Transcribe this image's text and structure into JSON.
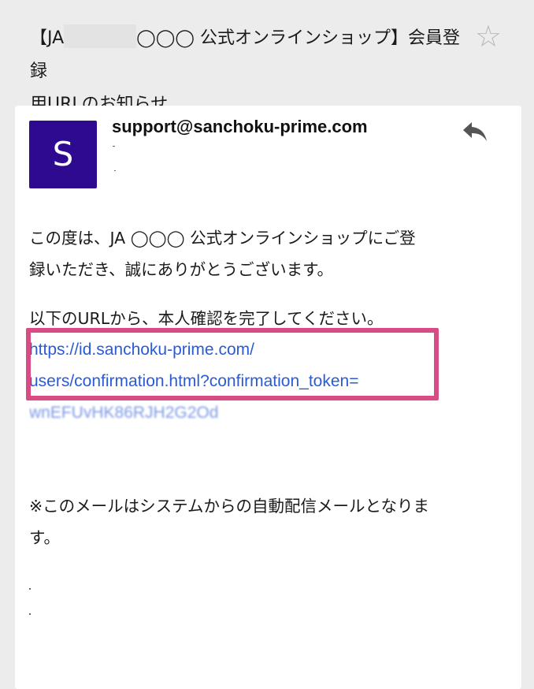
{
  "email": {
    "subject_part1": "【JA",
    "subject_part2": "◯◯◯ 公式オンラインショップ】会員登録",
    "subject_line2": "用URLのお知らせ",
    "sender": "support@sanchoku-prime.com",
    "avatar_letter": "S",
    "body": {
      "para1_line1": "この度は、JA ◯◯◯ 公式オンラインショップにご登",
      "para1_line2": "録いただき、誠にありがとうございます。",
      "para2": "以下のURLから、本人確認を完了してください。",
      "link_line1": "https://id.sanchoku-prime.com/",
      "link_line2": "users/confirmation.html?confirmation_token=",
      "link_line3": "wnEFUyHK86RJH2G2Qd",
      "notice_line1": "※このメールはシステムからの自動配信メールとなりま",
      "notice_line2": "す。"
    }
  },
  "icons": {
    "star": "star-icon",
    "reply": "reply-icon"
  },
  "colors": {
    "avatar": "#2d0a8f",
    "link": "#2a5bd7",
    "highlight": "#d94b84",
    "background": "#ececec"
  }
}
